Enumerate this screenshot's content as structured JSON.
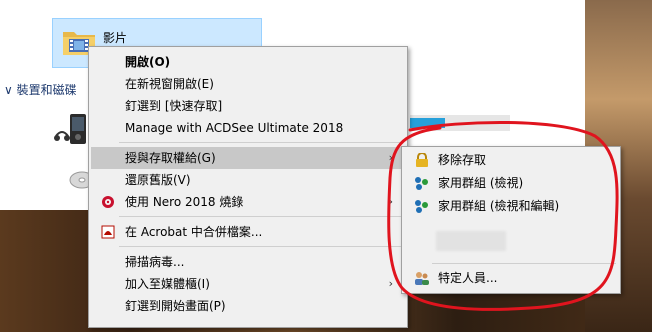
{
  "explorer": {
    "folder_name": "影片",
    "devices_header": "∨ 裝置和磁碟",
    "partial_text": "...."
  },
  "context_menu": {
    "items": [
      {
        "label": "開啟(O)"
      },
      {
        "label": "在新視窗開啟(E)"
      },
      {
        "label": "釘選到 [快速存取]"
      },
      {
        "label": "Manage with ACDSee Ultimate 2018"
      },
      {
        "label": "授與存取權給(G)",
        "submenu": true
      },
      {
        "label": "還原舊版(V)"
      },
      {
        "label": "使用 Nero 2018 燒錄",
        "submenu": true
      },
      {
        "label": "在 Acrobat 中合併檔案..."
      },
      {
        "label": "掃描病毒..."
      },
      {
        "label": "加入至媒體櫃(I)",
        "submenu": true
      },
      {
        "label": "釘選到開始畫面(P)"
      }
    ],
    "submenu_arrow": "›"
  },
  "sub_menu": {
    "items": [
      {
        "label": "移除存取",
        "icon": "lock-icon"
      },
      {
        "label": "家用群組 (檢視)",
        "icon": "homegroup-icon"
      },
      {
        "label": "家用群組 (檢視和編輯)",
        "icon": "homegroup-icon"
      },
      {
        "label": "特定人員...",
        "icon": "people-icon"
      }
    ]
  },
  "colors": {
    "menu_bg": "#f0f0f0",
    "highlight": "#cce8ff",
    "annotation": "#e0141e"
  }
}
